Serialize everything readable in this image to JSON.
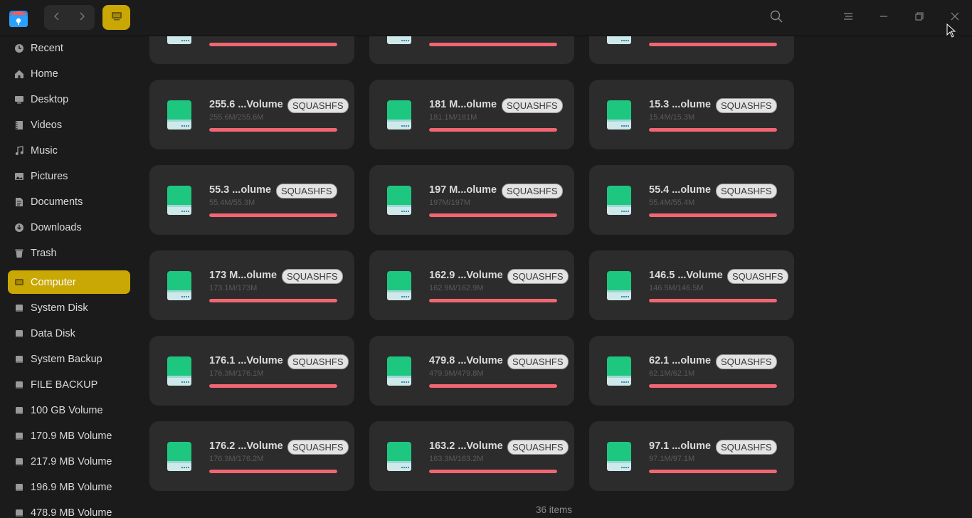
{
  "colors": {
    "accent": "#c9a805",
    "usage_bar": "#f16672",
    "disk_green": "#1ec77f"
  },
  "titlebar": {
    "app_icon": "file-manager-icon",
    "back_icon": "chevron-left-icon",
    "forward_icon": "chevron-right-icon",
    "view_icon": "computer-view-icon",
    "search_icon": "search-icon",
    "menu_icon": "hamburger-menu-icon",
    "minimize_icon": "minimize-icon",
    "maximize_icon": "restore-icon",
    "close_icon": "close-icon"
  },
  "sidebar": {
    "items": [
      {
        "label": "Recent",
        "icon": "clock-icon"
      },
      {
        "label": "Home",
        "icon": "home-icon"
      },
      {
        "label": "Desktop",
        "icon": "desktop-icon"
      },
      {
        "label": "Videos",
        "icon": "video-icon"
      },
      {
        "label": "Music",
        "icon": "music-icon"
      },
      {
        "label": "Pictures",
        "icon": "picture-icon"
      },
      {
        "label": "Documents",
        "icon": "document-icon"
      },
      {
        "label": "Downloads",
        "icon": "download-icon"
      },
      {
        "label": "Trash",
        "icon": "trash-icon"
      },
      {
        "label": "Computer",
        "icon": "computer-icon",
        "active": true
      },
      {
        "label": "System Disk",
        "icon": "disk-icon"
      },
      {
        "label": "Data Disk",
        "icon": "disk-icon"
      },
      {
        "label": "System Backup",
        "icon": "disk-icon"
      },
      {
        "label": "FILE BACKUP",
        "icon": "disk-icon"
      },
      {
        "label": "100 GB Volume",
        "icon": "disk-icon"
      },
      {
        "label": "170.9 MB Volume",
        "icon": "disk-icon"
      },
      {
        "label": "217.9 MB Volume",
        "icon": "disk-icon"
      },
      {
        "label": "196.9 MB Volume",
        "icon": "disk-icon"
      },
      {
        "label": "478.9 MB Volume",
        "icon": "disk-icon"
      }
    ]
  },
  "main": {
    "cards": [
      {
        "name": "",
        "fs": "",
        "usage": "",
        "fill": 1.0
      },
      {
        "name": "",
        "fs": "",
        "usage": "",
        "fill": 1.0
      },
      {
        "name": "",
        "fs": "",
        "usage": "",
        "fill": 1.0
      },
      {
        "name": "255.6 ...Volume",
        "fs": "SQUASHFS",
        "usage": "255.6M/255.6M",
        "fill": 1.0
      },
      {
        "name": "181 M...olume",
        "fs": "SQUASHFS",
        "usage": "181.1M/181M",
        "fill": 1.0
      },
      {
        "name": "15.3 ...olume",
        "fs": "SQUASHFS",
        "usage": "15.4M/15.3M",
        "fill": 1.0
      },
      {
        "name": "55.3 ...olume",
        "fs": "SQUASHFS",
        "usage": "55.4M/55.3M",
        "fill": 1.0
      },
      {
        "name": "197 M...olume",
        "fs": "SQUASHFS",
        "usage": "197M/197M",
        "fill": 1.0
      },
      {
        "name": "55.4 ...olume",
        "fs": "SQUASHFS",
        "usage": "55.4M/55.4M",
        "fill": 1.0
      },
      {
        "name": "173 M...olume",
        "fs": "SQUASHFS",
        "usage": "173.1M/173M",
        "fill": 1.0
      },
      {
        "name": "162.9 ...Volume",
        "fs": "SQUASHFS",
        "usage": "162.9M/162.9M",
        "fill": 1.0
      },
      {
        "name": "146.5 ...Volume",
        "fs": "SQUASHFS",
        "usage": "146.5M/146.5M",
        "fill": 1.0
      },
      {
        "name": "176.1 ...Volume",
        "fs": "SQUASHFS",
        "usage": "176.3M/176.1M",
        "fill": 1.0
      },
      {
        "name": "479.8 ...Volume",
        "fs": "SQUASHFS",
        "usage": "479.9M/479.8M",
        "fill": 1.0
      },
      {
        "name": "62.1 ...olume",
        "fs": "SQUASHFS",
        "usage": "62.1M/62.1M",
        "fill": 1.0
      },
      {
        "name": "176.2 ...Volume",
        "fs": "SQUASHFS",
        "usage": "176.3M/176.2M",
        "fill": 1.0
      },
      {
        "name": "163.2 ...Volume",
        "fs": "SQUASHFS",
        "usage": "163.3M/163.2M",
        "fill": 1.0
      },
      {
        "name": "97.1 ...olume",
        "fs": "SQUASHFS",
        "usage": "97.1M/97.1M",
        "fill": 1.0
      }
    ],
    "item_count": "36 items"
  }
}
